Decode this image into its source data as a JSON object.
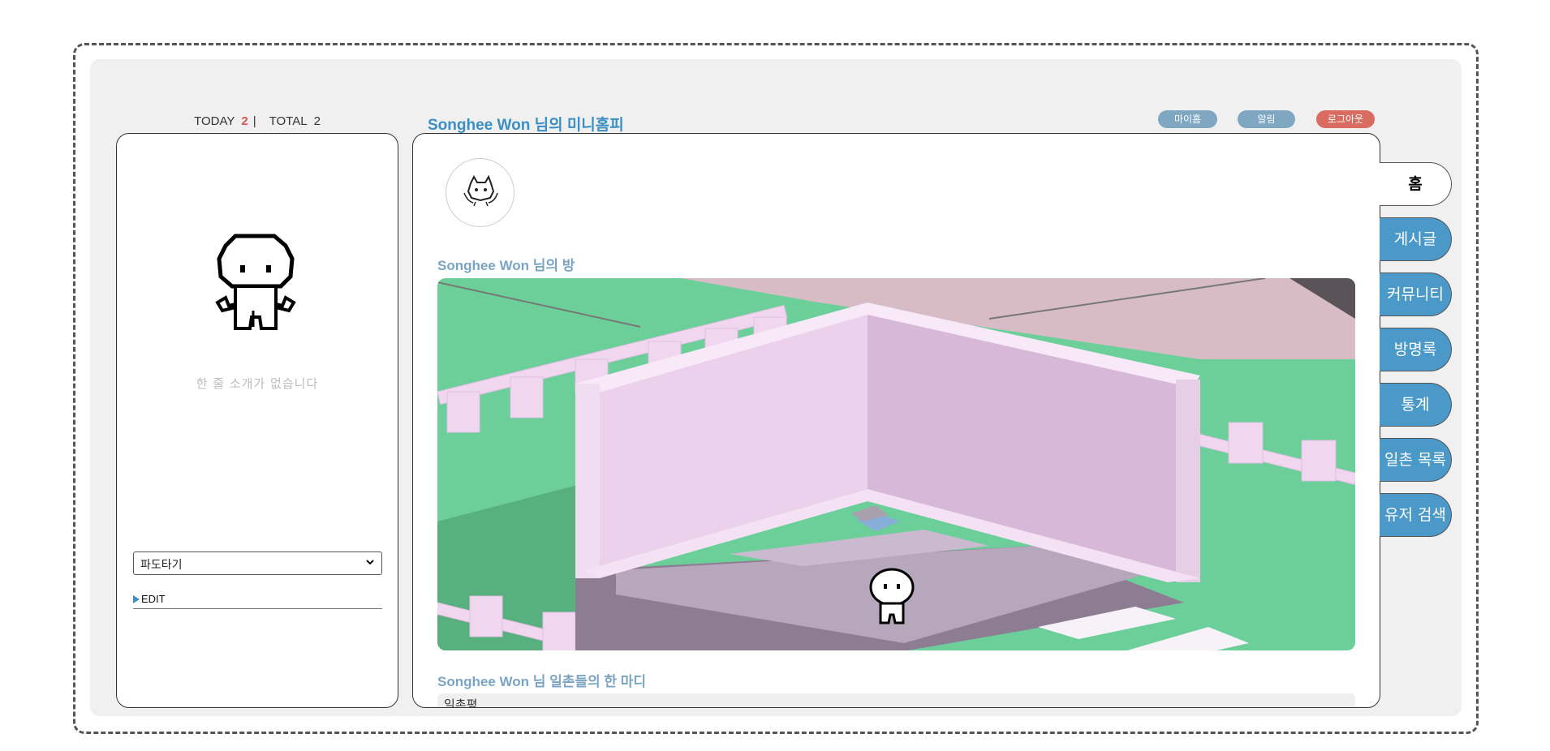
{
  "counter": {
    "today_label": "TODAY",
    "today_value": "2",
    "separator": "|",
    "total_label": "TOTAL",
    "total_value": "2"
  },
  "profile": {
    "bio": "한 줄 소개가 없습니다",
    "select_value": "파도타기",
    "edit_label": "EDIT"
  },
  "header": {
    "title": "Songhee Won 님의 미니홈피"
  },
  "top_buttons": {
    "my_home": "마이홈",
    "alarm": "알림",
    "logout": "로그아웃"
  },
  "main": {
    "room_title": "Songhee Won 님의 방",
    "comments_title": "Songhee Won 님 일촌들의 한 마디",
    "comments_placeholder": "일촌평"
  },
  "tabs": [
    {
      "label": "홈",
      "active": true
    },
    {
      "label": "게시글"
    },
    {
      "label": "커뮤니티"
    },
    {
      "label": "방명록"
    },
    {
      "label": "통계"
    },
    {
      "label": "일촌 목록"
    },
    {
      "label": "유저 검색"
    }
  ],
  "colors": {
    "accent_blue": "#3b8fc4",
    "tab_blue": "#4a99c9",
    "logout_red": "#d96b60",
    "pill_blue": "#7fa7c2",
    "grass": "#6ccf9a",
    "wall_pink": "#ecd0ec",
    "floor": "#b7a7bd"
  }
}
